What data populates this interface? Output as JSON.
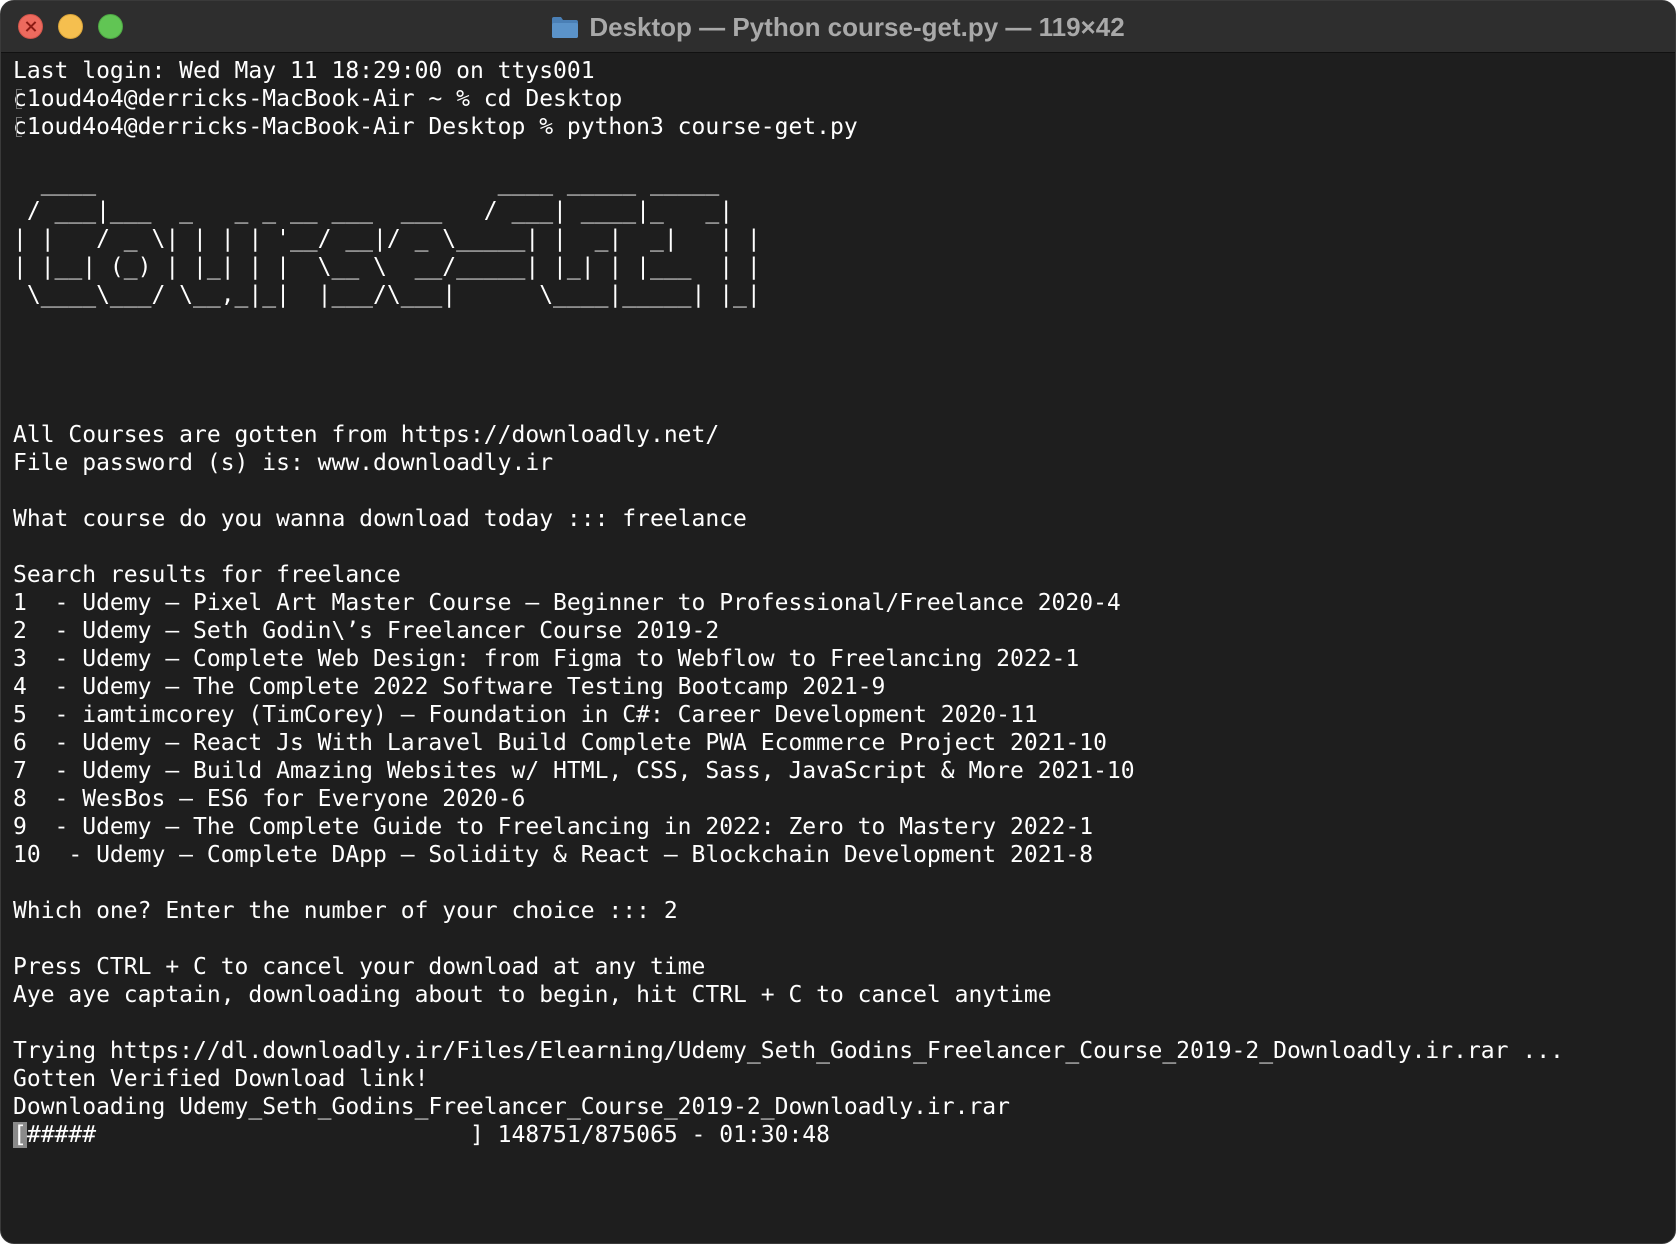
{
  "window": {
    "title": "Desktop — Python course-get.py — 119×42",
    "title_icon": "folder-icon",
    "controls": [
      "close",
      "minimize",
      "zoom"
    ]
  },
  "terminal": {
    "login_line": "Last login: Wed May 11 18:29:00 on ttys001",
    "prompt_lines": [
      "c1oud4o4@derricks-MacBook-Air ~ % cd Desktop",
      "c1oud4o4@derricks-MacBook-Air Desktop % python3 course-get.py"
    ],
    "banner_lines": [
      "  ____                             ____ _____ _____",
      " / ___|___  _   _ _ __ ___  ___   / ___| ____|_   _|",
      "| |   / _ \\| | | | '__/ __|/ _ \\_____| |  _|  _|   | |",
      "| |__| (_) | |_| | |  \\__ \\  __/_____| |_| | |___  | |",
      " \\____\\___/ \\__,_|_|  |___/\\___|      \\____|_____| |_|"
    ],
    "source_line": "All Courses are gotten from https://downloadly.net/",
    "password_line": "File password (s) is: www.downloadly.ir",
    "query_line": "What course do you wanna download today ::: freelance",
    "results_header": "Search results for freelance",
    "results": [
      "1  - Udemy – Pixel Art Master Course – Beginner to Professional/Freelance 2020-4",
      "2  - Udemy – Seth Godin\\’s Freelancer Course 2019-2",
      "3  - Udemy – Complete Web Design: from Figma to Webflow to Freelancing 2022-1",
      "4  - Udemy – The Complete 2022 Software Testing Bootcamp 2021-9",
      "5  - iamtimcorey (TimCorey) – Foundation in C#: Career Development 2020-11",
      "6  - Udemy – React Js With Laravel Build Complete PWA Ecommerce Project 2021-10",
      "7  - Udemy – Build Amazing Websites w/ HTML, CSS, Sass, JavaScript & More 2021-10",
      "8  - WesBos – ES6 for Everyone 2020-6",
      "9  - Udemy – The Complete Guide to Freelancing in 2022: Zero to Mastery 2022-1",
      "10  - Udemy – Complete DApp – Solidity & React – Blockchain Development 2021-8"
    ],
    "choice_line": "Which one? Enter the number of your choice ::: 2",
    "cancel_hint": "Press CTRL + C to cancel your download at any time",
    "begin_line": "Aye aye captain, downloading about to begin, hit CTRL + C to cancel anytime",
    "trying_line": "Trying https://dl.downloadly.ir/Files/Elearning/Udemy_Seth_Godins_Freelancer_Course_2019-2_Downloadly.ir.rar ...",
    "verified_line": "Gotten Verified Download link!",
    "downloading_line": "Downloading Udemy_Seth_Godins_Freelancer_Course_2019-2_Downloadly.ir.rar",
    "progress": {
      "cursor_char": "[",
      "bar_text": "#####                           ] 148751/875065 - 01:30:48",
      "completed": 148751,
      "total": 875065,
      "elapsed": "01:30:48"
    }
  }
}
